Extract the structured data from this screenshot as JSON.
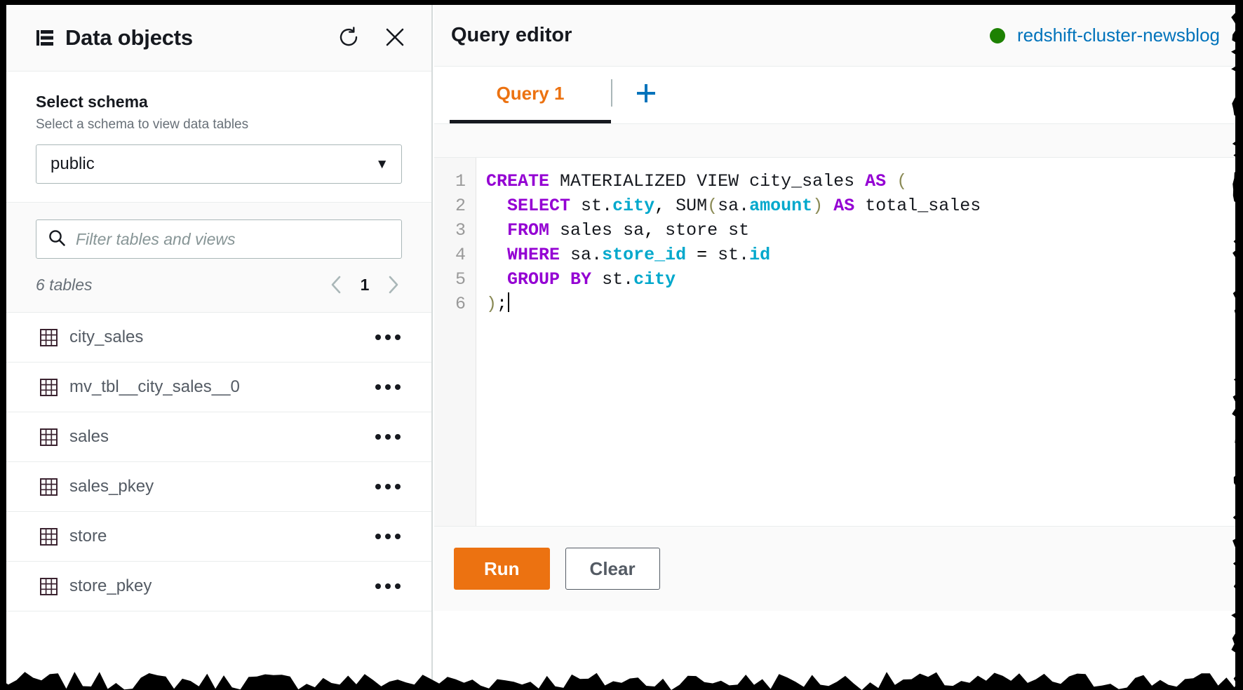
{
  "left_panel": {
    "title": "Data objects",
    "title_icon": "tree-list-icon",
    "refresh_icon": "refresh-icon",
    "close_icon": "close-icon",
    "schema": {
      "label": "Select schema",
      "hint": "Select a schema to view data tables",
      "selected": "public",
      "caret_icon": "chevron-down-icon"
    },
    "filter": {
      "placeholder": "Filter tables and views",
      "value": "",
      "search_icon": "search-icon"
    },
    "count_text": "6 tables",
    "pagination": {
      "prev_icon": "chevron-left-icon",
      "page": "1",
      "next_icon": "chevron-right-icon"
    },
    "tables": [
      {
        "name": "city_sales",
        "icon": "table-grid-icon",
        "menu_icon": "ellipsis-icon"
      },
      {
        "name": "mv_tbl__city_sales__0",
        "icon": "table-grid-icon",
        "menu_icon": "ellipsis-icon"
      },
      {
        "name": "sales",
        "icon": "table-grid-icon",
        "menu_icon": "ellipsis-icon"
      },
      {
        "name": "sales_pkey",
        "icon": "table-grid-icon",
        "menu_icon": "ellipsis-icon"
      },
      {
        "name": "store",
        "icon": "table-grid-icon",
        "menu_icon": "ellipsis-icon"
      },
      {
        "name": "store_pkey",
        "icon": "table-grid-icon",
        "menu_icon": "ellipsis-icon"
      }
    ]
  },
  "query_editor": {
    "title": "Query editor",
    "cluster": {
      "name": "redshift-cluster-newsblog",
      "status_color": "#1d8102",
      "status_icon": "status-dot-icon"
    },
    "tabs": [
      {
        "label": "Query 1",
        "active": true
      }
    ],
    "add_tab_icon": "plus-icon",
    "accent_color": "#ec7211",
    "link_color": "#0073bb",
    "editor": {
      "line_numbers": [
        "1",
        "2",
        "3",
        "4",
        "5",
        "6"
      ],
      "lines": [
        "CREATE MATERIALIZED VIEW city_sales AS (",
        "  SELECT st.city, SUM(sa.amount) AS total_sales",
        "  FROM sales sa, store st",
        "  WHERE sa.store_id = st.id",
        "  GROUP BY st.city",
        ");"
      ],
      "cursor_line": 6,
      "syntax_colors": {
        "keyword": "#9400d3",
        "column": "#00a8cc",
        "identifier": "#16191f",
        "paren": "#8a8a55"
      }
    },
    "actions": {
      "run_label": "Run",
      "clear_label": "Clear"
    }
  }
}
